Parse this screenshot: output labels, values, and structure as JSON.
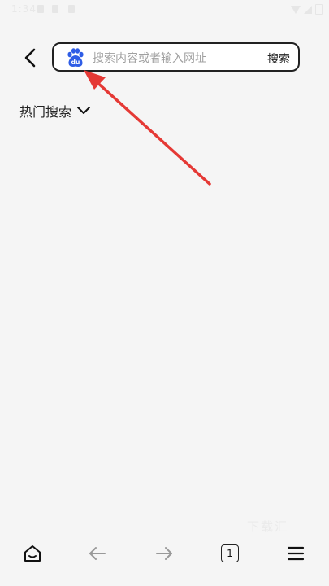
{
  "status_bar": {
    "time": "1:34"
  },
  "search": {
    "placeholder": "搜索内容或者输入网址",
    "value": "",
    "engine_icon": "baidu-paw-icon",
    "submit_label": "搜索"
  },
  "hot_search": {
    "label": "热门搜索"
  },
  "watermark": {
    "text": "下载汇"
  },
  "bottom_nav": {
    "tab_count": "1"
  },
  "colors": {
    "background": "#f5f5f5",
    "baidu_blue": "#2f5de6",
    "annotation_red": "#e53935"
  }
}
